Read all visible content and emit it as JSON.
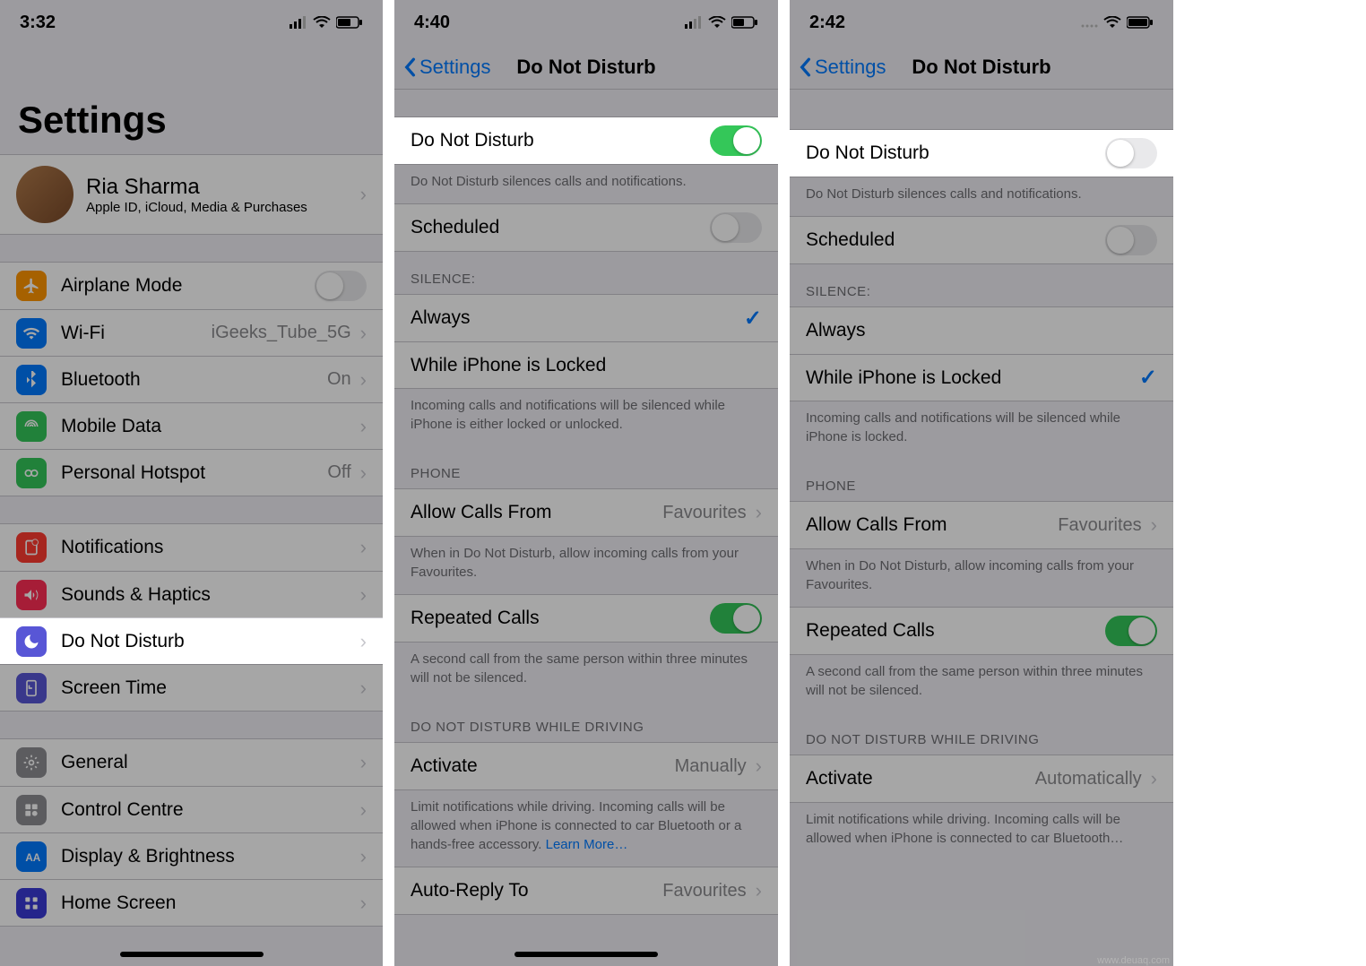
{
  "pane1": {
    "time": "3:32",
    "title": "Settings",
    "profile": {
      "name": "Ria Sharma",
      "subtitle": "Apple ID, iCloud, Media & Purchases"
    },
    "group1": [
      {
        "icon": "airplane",
        "color": "#ff9500",
        "label": "Airplane Mode",
        "type": "toggle",
        "state": "off"
      },
      {
        "icon": "wifi",
        "color": "#007aff",
        "label": "Wi-Fi",
        "value": "iGeeks_Tube_5G",
        "type": "nav"
      },
      {
        "icon": "bluetooth",
        "color": "#007aff",
        "label": "Bluetooth",
        "value": "On",
        "type": "nav"
      },
      {
        "icon": "mobiledata",
        "color": "#34c759",
        "label": "Mobile Data",
        "type": "nav"
      },
      {
        "icon": "hotspot",
        "color": "#34c759",
        "label": "Personal Hotspot",
        "value": "Off",
        "type": "nav"
      }
    ],
    "group2": [
      {
        "icon": "notifications",
        "color": "#ff3b30",
        "label": "Notifications",
        "type": "nav"
      },
      {
        "icon": "sounds",
        "color": "#ff2d55",
        "label": "Sounds & Haptics",
        "type": "nav"
      },
      {
        "icon": "moon",
        "color": "#5856d6",
        "label": "Do Not Disturb",
        "type": "nav",
        "highlight": true
      },
      {
        "icon": "screentime",
        "color": "#5856d6",
        "label": "Screen Time",
        "type": "nav"
      }
    ],
    "group3": [
      {
        "icon": "general",
        "color": "#8e8e93",
        "label": "General",
        "type": "nav"
      },
      {
        "icon": "controlcentre",
        "color": "#8e8e93",
        "label": "Control Centre",
        "type": "nav"
      },
      {
        "icon": "display",
        "color": "#007aff",
        "label": "Display & Brightness",
        "type": "nav"
      },
      {
        "icon": "homescreen",
        "color": "#3a3ad6",
        "label": "Home Screen",
        "type": "nav"
      }
    ]
  },
  "pane2": {
    "time": "4:40",
    "back": "Settings",
    "title": "Do Not Disturb",
    "row_dnd": {
      "label": "Do Not Disturb",
      "state": "on"
    },
    "footer_dnd": "Do Not Disturb silences calls and notifications.",
    "row_scheduled": {
      "label": "Scheduled",
      "state": "off"
    },
    "header_silence": "SILENCE:",
    "silence_rows": [
      {
        "label": "Always",
        "checked": true
      },
      {
        "label": "While iPhone is Locked",
        "checked": false
      }
    ],
    "footer_silence": "Incoming calls and notifications will be silenced while iPhone is either locked or unlocked.",
    "header_phone": "PHONE",
    "row_allowcalls": {
      "label": "Allow Calls From",
      "value": "Favourites"
    },
    "footer_allowcalls": "When in Do Not Disturb, allow incoming calls from your Favourites.",
    "row_repeated": {
      "label": "Repeated Calls",
      "state": "on"
    },
    "footer_repeated": "A second call from the same person within three minutes will not be silenced.",
    "header_driving": "DO NOT DISTURB WHILE DRIVING",
    "row_activate": {
      "label": "Activate",
      "value": "Manually"
    },
    "footer_activate_pre": "Limit notifications while driving. Incoming calls will be allowed when iPhone is connected to car Bluetooth or a hands-free accessory. ",
    "footer_activate_link": "Learn More…",
    "row_autoreply": {
      "label": "Auto-Reply To",
      "value": "Favourites"
    }
  },
  "pane3": {
    "time": "2:42",
    "back": "Settings",
    "title": "Do Not Disturb",
    "row_dnd": {
      "label": "Do Not Disturb",
      "state": "off"
    },
    "footer_dnd": "Do Not Disturb silences calls and notifications.",
    "row_scheduled": {
      "label": "Scheduled",
      "state": "off"
    },
    "header_silence": "SILENCE:",
    "silence_rows": [
      {
        "label": "Always",
        "checked": false
      },
      {
        "label": "While iPhone is Locked",
        "checked": true
      }
    ],
    "footer_silence": "Incoming calls and notifications will be silenced while iPhone is locked.",
    "header_phone": "PHONE",
    "row_allowcalls": {
      "label": "Allow Calls From",
      "value": "Favourites"
    },
    "footer_allowcalls": "When in Do Not Disturb, allow incoming calls from your Favourites.",
    "row_repeated": {
      "label": "Repeated Calls",
      "state": "on"
    },
    "footer_repeated": "A second call from the same person within three minutes will not be silenced.",
    "header_driving": "DO NOT DISTURB WHILE DRIVING",
    "row_activate": {
      "label": "Activate",
      "value": "Automatically"
    },
    "footer_activate": "Limit notifications while driving. Incoming calls will be allowed when iPhone is connected to car Bluetooth…"
  },
  "watermark": "www.deuaq.com"
}
